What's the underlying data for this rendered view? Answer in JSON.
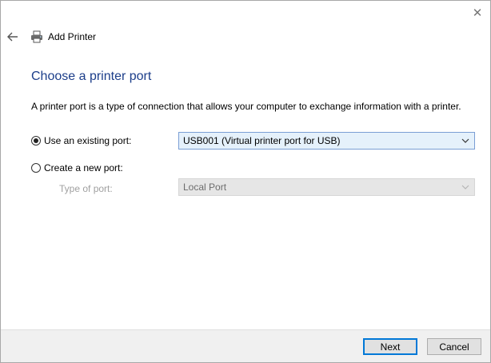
{
  "window": {
    "title": "Add Printer",
    "close_glyph": "✕"
  },
  "page": {
    "heading": "Choose a printer port",
    "description": "A printer port is a type of connection that allows your computer to exchange information with a printer."
  },
  "options": {
    "existing": {
      "label": "Use an existing port:",
      "selected": true,
      "value": "USB001 (Virtual printer port for USB)"
    },
    "new": {
      "label": "Create a new port:",
      "selected": false,
      "type_label": "Type of port:",
      "value": "Local Port"
    }
  },
  "footer": {
    "next_label": "Next",
    "cancel_label": "Cancel"
  },
  "colors": {
    "heading": "#1c3e8a",
    "accent": "#0078d7",
    "select_bg": "#e5f1fb"
  },
  "icons": {
    "back": "arrow-left-icon",
    "printer": "printer-icon",
    "close": "close-icon",
    "chevron": "chevron-down-icon"
  }
}
